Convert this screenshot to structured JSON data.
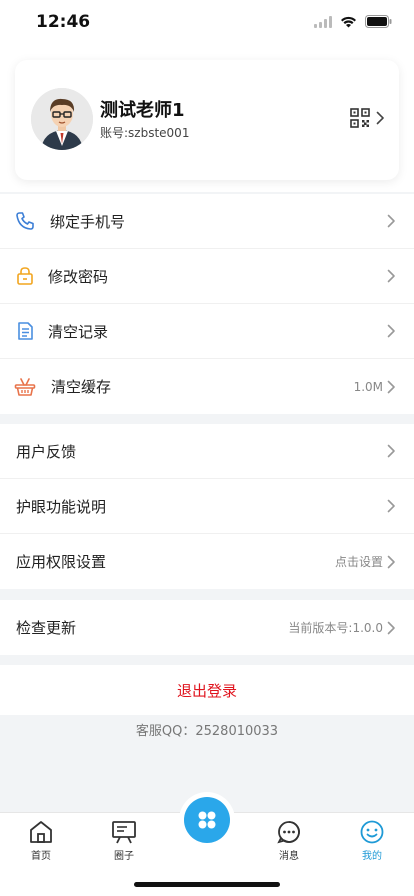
{
  "status_bar": {
    "time": "12:46"
  },
  "profile": {
    "name": "测试老师1",
    "account": "账号:szbste001"
  },
  "section1": [
    {
      "label": "绑定手机号",
      "value": ""
    },
    {
      "label": "修改密码",
      "value": ""
    },
    {
      "label": "清空记录",
      "value": ""
    },
    {
      "label": "清空缓存",
      "value": "1.0M"
    }
  ],
  "section2": [
    {
      "label": "用户反馈",
      "value": ""
    },
    {
      "label": "护眼功能说明",
      "value": ""
    },
    {
      "label": "应用权限设置",
      "value": "点击设置"
    }
  ],
  "section3": [
    {
      "label": "检查更新",
      "value": "当前版本号:1.0.0"
    }
  ],
  "logout": "退出登录",
  "service_qq": "客服QQ：2528010033",
  "tabs": [
    {
      "label": "首页"
    },
    {
      "label": "圈子"
    },
    {
      "label": ""
    },
    {
      "label": "消息"
    },
    {
      "label": "我的"
    }
  ],
  "colors": {
    "accent": "#1f9ad6",
    "danger": "#e0141e",
    "phone_icon": "#3d7fd6",
    "lock_icon": "#f2a51f",
    "record_icon": "#4a8fe0",
    "cache_icon": "#e8734a"
  }
}
